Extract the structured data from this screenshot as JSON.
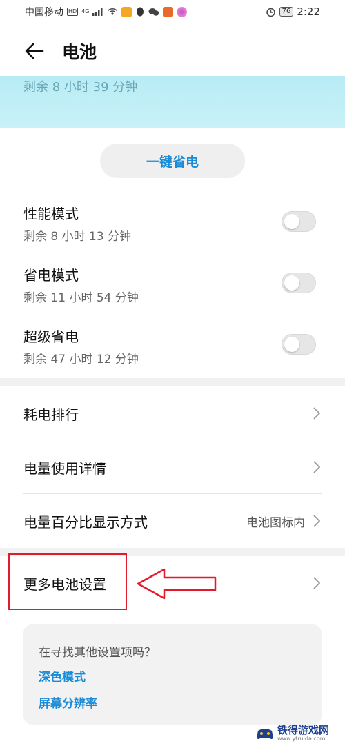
{
  "status_bar": {
    "carrier": "中国移动",
    "hd": "HD",
    "network": "4G",
    "battery_level": "76",
    "time": "2:22",
    "icons": [
      "hd-icon",
      "signal-icon",
      "wifi-hotspot-icon",
      "weibo-icon",
      "qq-icon",
      "wechat-icon",
      "app-icon",
      "app-icon",
      "alarm-icon",
      "battery-icon"
    ]
  },
  "header": {
    "title": "电池",
    "back_icon": "arrow-left-icon"
  },
  "banner": {
    "remaining": "剩余 8 小时 39 分钟",
    "color": "#c2eff7"
  },
  "save_button": {
    "label": "一键省电",
    "color": "#1a8bd6"
  },
  "modes": [
    {
      "title": "性能模式",
      "subtitle": "剩余 8 小时 13 分钟",
      "enabled": false
    },
    {
      "title": "省电模式",
      "subtitle": "剩余 11 小时 54 分钟",
      "enabled": false
    },
    {
      "title": "超级省电",
      "subtitle": "剩余 47 小时 12 分钟",
      "enabled": false
    }
  ],
  "list": [
    {
      "label": "耗电排行",
      "value": ""
    },
    {
      "label": "电量使用详情",
      "value": ""
    },
    {
      "label": "电量百分比显示方式",
      "value": "电池图标内"
    },
    {
      "label": "更多电池设置",
      "value": ""
    }
  ],
  "suggestions": {
    "title": "在寻找其他设置项吗？",
    "links": [
      "深色模式",
      "屏幕分辨率"
    ]
  },
  "annotation": {
    "highlight_color": "#e5192c"
  },
  "watermark": {
    "text": "铁得游戏网",
    "url": "www.ytruida.com"
  }
}
